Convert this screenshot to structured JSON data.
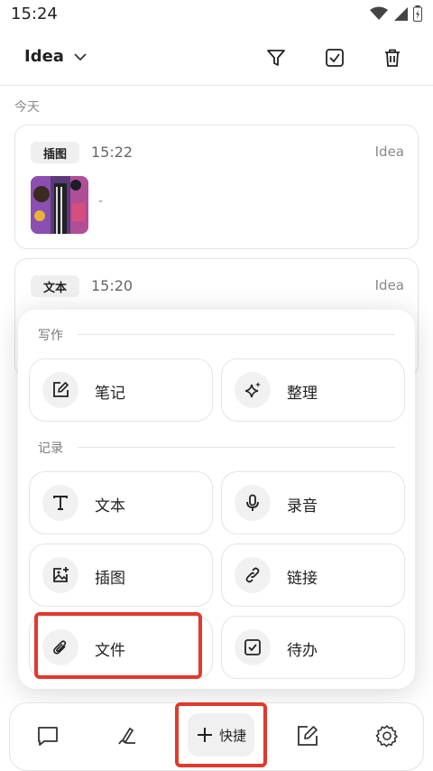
{
  "status_bar": {
    "time": "15:24"
  },
  "header": {
    "title": "Idea"
  },
  "date_group": "今天",
  "cards": [
    {
      "tag": "插图",
      "time": "15:22",
      "category": "Idea",
      "preview": "-"
    },
    {
      "tag": "文本",
      "time": "15:20",
      "category": "Idea"
    }
  ],
  "quick_panel": {
    "sections": [
      {
        "label": "写作",
        "items": [
          {
            "label": "笔记",
            "icon": "edit-note-icon"
          },
          {
            "label": "整理",
            "icon": "sparkles-icon"
          }
        ]
      },
      {
        "label": "记录",
        "items": [
          {
            "label": "文本",
            "icon": "text-icon"
          },
          {
            "label": "录音",
            "icon": "microphone-icon"
          },
          {
            "label": "插图",
            "icon": "image-add-icon"
          },
          {
            "label": "链接",
            "icon": "link-icon"
          },
          {
            "label": "文件",
            "icon": "paperclip-icon"
          },
          {
            "label": "待办",
            "icon": "checkbox-icon"
          }
        ]
      }
    ]
  },
  "bottom_nav": {
    "quick_label": "快捷"
  },
  "colors": {
    "highlight": "#e1392b",
    "accent": "#222222"
  }
}
